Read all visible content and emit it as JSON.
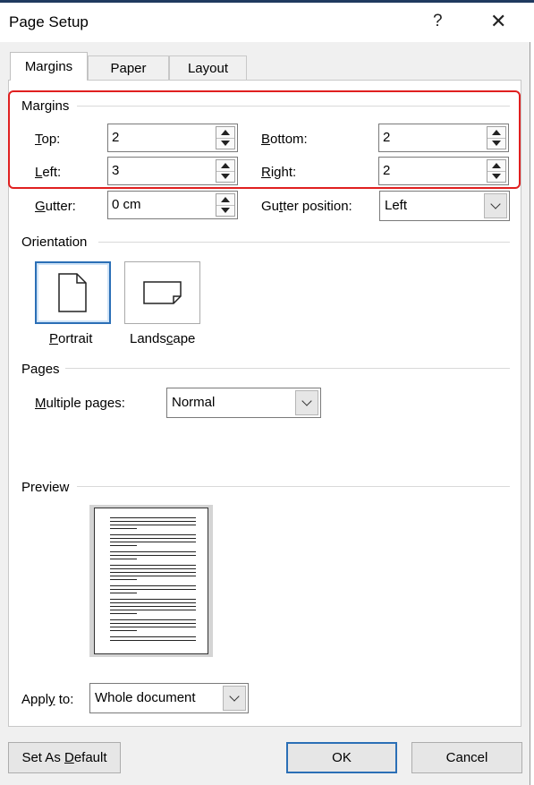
{
  "window": {
    "title": "Page Setup",
    "help_glyph": "?",
    "close_glyph": "✕"
  },
  "tabs": [
    {
      "label": "Margins",
      "active": true
    },
    {
      "label": "Paper",
      "active": false
    },
    {
      "label": "Layout",
      "active": false
    }
  ],
  "margins": {
    "group_label": "Margins",
    "top": {
      "key": "T",
      "rest": "op:",
      "value": "2"
    },
    "left": {
      "key": "L",
      "rest": "eft:",
      "value": "3"
    },
    "bottom": {
      "key": "B",
      "rest": "ottom:",
      "value": "2"
    },
    "right": {
      "key": "R",
      "rest": "ight:",
      "value": "2"
    },
    "gutter": {
      "key": "G",
      "rest": "utter:",
      "value": "0 cm"
    },
    "gutter_position": {
      "pre": "Gu",
      "key": "t",
      "rest": "ter position:",
      "value": "Left"
    }
  },
  "orientation": {
    "group_label": "Orientation",
    "portrait": {
      "key": "P",
      "rest": "ortrait",
      "icon": "portrait-page-icon",
      "selected": true
    },
    "landscape": {
      "pre": "Lands",
      "key": "c",
      "rest": "ape",
      "icon": "landscape-page-icon"
    }
  },
  "pages": {
    "group_label": "Pages",
    "multiple_pages": {
      "key": "M",
      "rest": "ultiple pages:",
      "value": "Normal"
    }
  },
  "preview": {
    "group_label": "Preview"
  },
  "apply_to": {
    "pre": "Appl",
    "key": "y",
    "rest": " to:",
    "value": "Whole document"
  },
  "buttons": {
    "set_default": {
      "pre": "Set As ",
      "key": "D",
      "rest": "efault"
    },
    "ok": "OK",
    "cancel": "Cancel"
  },
  "colors": {
    "accent": "#2b6fb6",
    "highlight": "#e02020"
  }
}
